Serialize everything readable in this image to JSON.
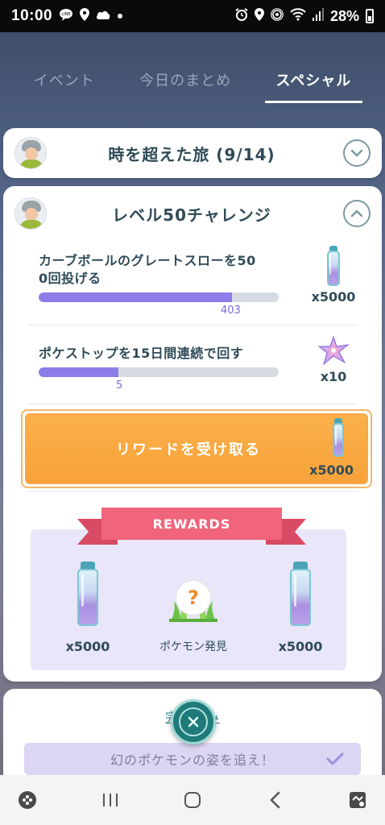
{
  "status_bar": {
    "time": "10:00",
    "left_icons": [
      "line-icon",
      "location-icon",
      "cloud-icon",
      "dot-icon"
    ],
    "right_icons": [
      "alarm-icon",
      "location-icon",
      "hotspot-icon",
      "wifi-icon",
      "signal-icon"
    ],
    "battery": "28%"
  },
  "tabs": [
    {
      "label": "イベント",
      "active": false
    },
    {
      "label": "今日のまとめ",
      "active": false
    },
    {
      "label": "スペシャル",
      "active": true
    }
  ],
  "card1": {
    "title": "時を超えた旅 (9/14)",
    "toggle_icon": "chevron-down-icon"
  },
  "card2": {
    "title": "レベル50チャレンジ",
    "toggle_icon": "chevron-up-icon",
    "tasks": [
      {
        "text": "カーブボールのグレートスローを500回投げる",
        "text_line1": "カーブボールのグレートスローを50",
        "text_line2": "0回投げる",
        "progress_value": "403",
        "progress_fraction": 0.806,
        "reward_icon": "stardust-potion-icon",
        "reward_count": "x5000"
      },
      {
        "text": "ポケストップを15日間連続で回す",
        "progress_value": "5",
        "progress_fraction": 0.333,
        "reward_icon": "star-piece-icon",
        "reward_count": "x10"
      }
    ],
    "claim_button": {
      "label": "リワードを受け取る",
      "reward_icon": "stardust-potion-icon",
      "reward_count": "x5000"
    },
    "rewards": {
      "banner": "REWARDS",
      "items": [
        {
          "icon": "stardust-potion-icon",
          "label": "x5000"
        },
        {
          "icon": "mystery-encounter-icon",
          "label": "ポケモン発見"
        },
        {
          "icon": "stardust-potion-icon",
          "label": "x5000"
        }
      ]
    }
  },
  "bottom_card": {
    "completed_link": "完了済み",
    "pending_task": "幻のポケモンの姿を追え！"
  },
  "close_button_icon": "close-icon",
  "nav_bar": {
    "left_icon": "game-launcher-icon",
    "recent_icon": "recents-icon",
    "home_icon": "home-icon",
    "back_icon": "back-icon",
    "right_icon": "screen-capture-icon"
  },
  "colors": {
    "accent_teal": "#1e7b7a",
    "progress_purple": "#8c7de8",
    "claim_orange": "#f7a239",
    "ribbon_pink": "#f0647c"
  }
}
